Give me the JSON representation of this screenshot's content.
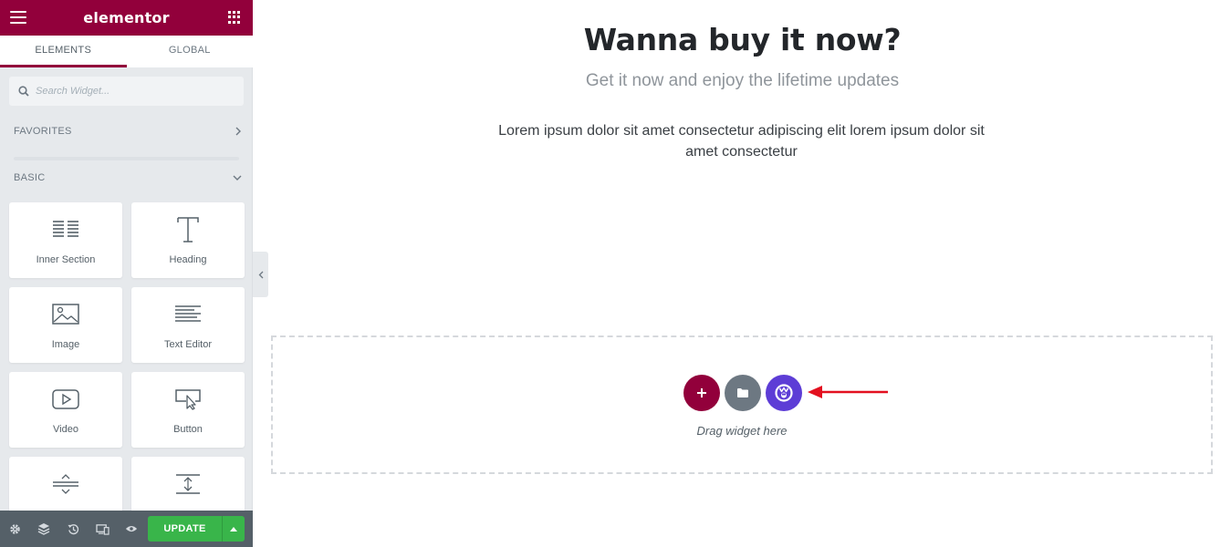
{
  "editor": {
    "logo": "elementor",
    "tabs": [
      "ELEMENTS",
      "GLOBAL"
    ],
    "search_placeholder": "Search Widget...",
    "categories": {
      "favorites": "FAVORITES",
      "basic": "BASIC"
    },
    "widgets": [
      "Inner Section",
      "Heading",
      "Image",
      "Text Editor",
      "Video",
      "Button",
      "Divider",
      "Spacer"
    ],
    "footer": {
      "icons": [
        "settings-icon",
        "layers-icon",
        "history-icon",
        "responsive-icon",
        "preview-icon"
      ],
      "update_label": "UPDATE"
    },
    "colors": {
      "brand": "#92003b",
      "update": "#39b54a",
      "template": "#5d3dd6"
    }
  },
  "page": {
    "headline": "Wanna buy it now?",
    "subline": "Get it now and enjoy the lifetime updates",
    "body": "Lorem ipsum dolor sit amet consectetur adipiscing elit lorem ipsum dolor sit amet consectetur",
    "dropzone_text": "Drag widget here"
  }
}
